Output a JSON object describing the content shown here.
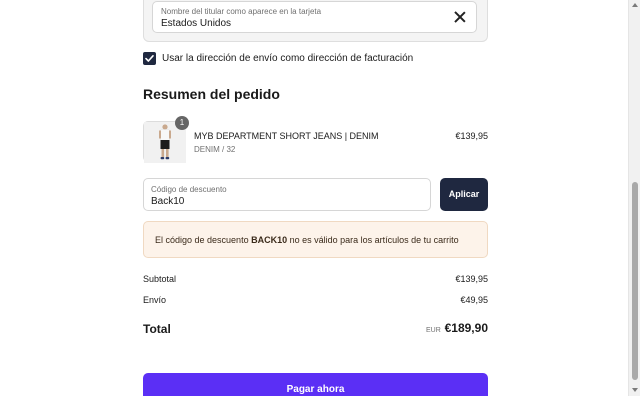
{
  "billing": {
    "card_holder_label": "Nombre del titular como aparece en la tarjeta",
    "country_value": "Estados Unidos",
    "use_shipping_checked": true,
    "use_shipping_label": "Usar la dirección de envío como dirección de facturación"
  },
  "summary": {
    "title": "Resumen del pedido",
    "product": {
      "quantity": "1",
      "name": "MYB DEPARTMENT SHORT JEANS | DENIM",
      "variant": "DENIM / 32",
      "price": "€139,95"
    },
    "discount": {
      "label": "Código de descuento",
      "value": "Back10",
      "apply_label": "Aplicar",
      "error_prefix": "El código de descuento ",
      "error_code": "BACK10",
      "error_suffix": " no es válido para los artículos de tu carrito"
    },
    "subtotal_label": "Subtotal",
    "subtotal_value": "€139,95",
    "shipping_label": "Envío",
    "shipping_value": "€49,95",
    "total_label": "Total",
    "total_currency": "EUR",
    "total_value": "€189,90"
  },
  "pay_button_label": "Pagar ahora",
  "colors": {
    "dark_button": "#1f2840",
    "pay_button": "#5b2ff5",
    "alert_bg": "#fdf3ea"
  },
  "icons": {
    "clear": "close-icon",
    "checkbox": "checkmark-icon"
  }
}
